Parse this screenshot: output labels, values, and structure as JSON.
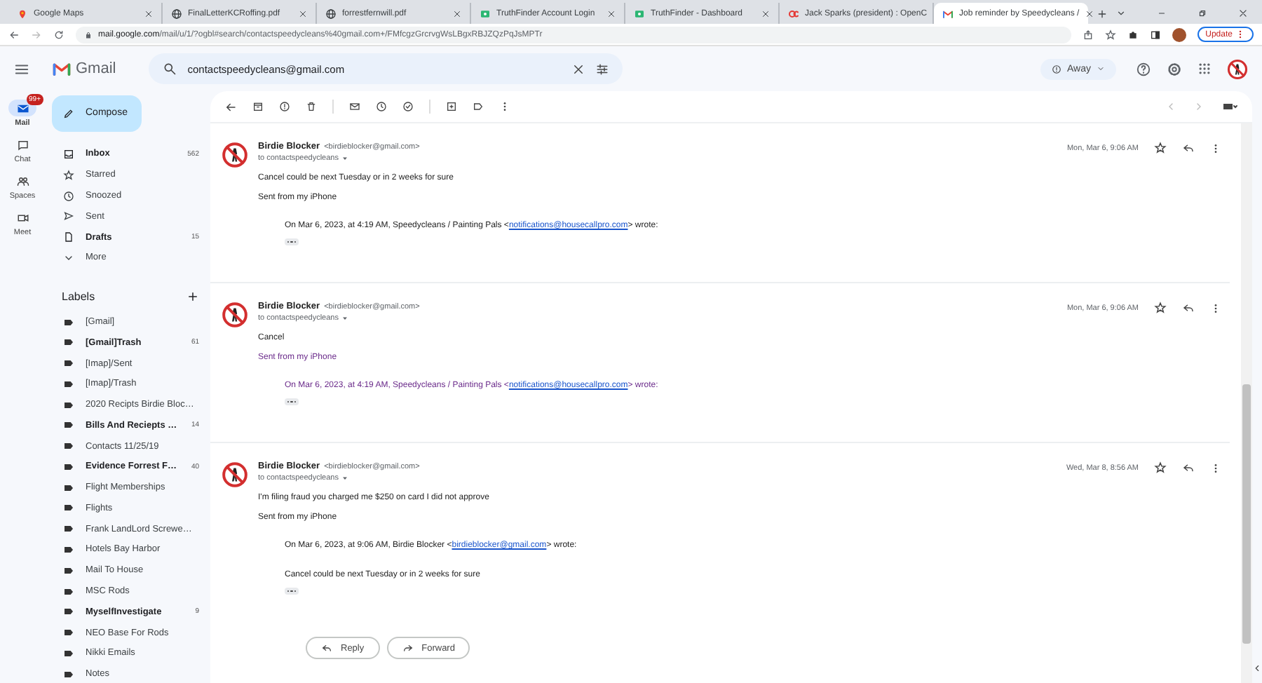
{
  "browser": {
    "tabs": [
      {
        "title": "Google Maps",
        "kind": "pin",
        "selected": false
      },
      {
        "title": "FinalLetterKCRoffing.pdf",
        "kind": "globe",
        "selected": false
      },
      {
        "title": "forrestfernwill.pdf",
        "kind": "globe",
        "selected": false
      },
      {
        "title": "TruthFinder Account Login",
        "kind": "finder",
        "selected": false
      },
      {
        "title": "TruthFinder - Dashboard",
        "kind": "finder",
        "selected": false
      },
      {
        "title": "Jack Sparks (president) : OpenC",
        "kind": "oc",
        "selected": false
      },
      {
        "title": "Job reminder by Speedycleans /",
        "kind": "gmail",
        "selected": true
      }
    ],
    "url_host": "mail.google.com",
    "url_path": "/mail/u/1/?ogbl#search/contactspeedycleans%40gmail.com+/FMfcgzGrcrvgWsLBgxRBJZQzPqJsMPTr",
    "update_label": "Update"
  },
  "gmail": {
    "brand": "Gmail",
    "search_value": "contactspeedycleans@gmail.com",
    "status": "Away"
  },
  "rail": [
    {
      "label": "Mail",
      "kind": "mail",
      "selected": true,
      "badge": "99+"
    },
    {
      "label": "Chat",
      "kind": "chat",
      "selected": false
    },
    {
      "label": "Spaces",
      "kind": "people",
      "selected": false
    },
    {
      "label": "Meet",
      "kind": "video",
      "selected": false
    }
  ],
  "compose": "Compose",
  "folders": [
    {
      "label": "Inbox",
      "kind": "inbox",
      "count": "562",
      "unread": true
    },
    {
      "label": "Starred",
      "kind": "star",
      "unread": false
    },
    {
      "label": "Snoozed",
      "kind": "clock",
      "unread": false
    },
    {
      "label": "Sent",
      "kind": "send",
      "unread": false
    },
    {
      "label": "Drafts",
      "kind": "file",
      "count": "15",
      "unread": true
    },
    {
      "label": "More",
      "kind": "chevron",
      "unread": false
    }
  ],
  "labels_title": "Labels",
  "labels": [
    {
      "name": "[Gmail]",
      "unread": false
    },
    {
      "name": "[Gmail]Trash",
      "count": "61",
      "unread": true
    },
    {
      "name": "[Imap]/Sent",
      "unread": false
    },
    {
      "name": "[Imap]/Trash",
      "unread": false
    },
    {
      "name": "2020 Recipts Birdie Bloc…",
      "unread": false
    },
    {
      "name": "Bills And Reciepts …",
      "count": "14",
      "unread": true
    },
    {
      "name": "Contacts 11/25/19",
      "unread": false
    },
    {
      "name": "Evidence Forrest F…",
      "count": "40",
      "unread": true
    },
    {
      "name": "Flight Memberships",
      "unread": false
    },
    {
      "name": "Flights",
      "unread": false
    },
    {
      "name": "Frank LandLord Screwe…",
      "unread": false
    },
    {
      "name": "Hotels Bay Harbor",
      "unread": false
    },
    {
      "name": "Mail To House",
      "unread": false
    },
    {
      "name": "MSC Rods",
      "unread": false
    },
    {
      "name": "MyselfInvestigate",
      "count": "9",
      "unread": true
    },
    {
      "name": "NEO Base For Rods",
      "unread": false
    },
    {
      "name": "Nikki Emails",
      "unread": false
    },
    {
      "name": "Notes",
      "unread": false
    }
  ],
  "messages": [
    {
      "sender": "Birdie Blocker",
      "email": "<birdieblocker@gmail.com>",
      "to": "to contactspeedycleans",
      "date": "Mon, Mar 6, 9:06 AM",
      "body": [
        {
          "text": "Cancel could be next Tuesday or in 2 weeks for sure"
        },
        {
          "text": "Sent from my iPhone"
        }
      ],
      "quote": {
        "prefix": "On Mar 6, 2023, at 4:19 AM, Speedycleans / Painting Pals <",
        "link": "notifications@housecallpro.com",
        "suffix": "> wrote:"
      }
    },
    {
      "sender": "Birdie Blocker",
      "email": "<birdieblocker@gmail.com>",
      "to": "to contactspeedycleans",
      "date": "Mon, Mar 6, 9:06 AM",
      "body": [
        {
          "text": "Cancel"
        },
        {
          "text": "Sent from my iPhone",
          "color": "#6a2a8a"
        }
      ],
      "quote": {
        "prefix": "On Mar 6, 2023, at 4:19 AM, Speedycleans / Painting Pals <",
        "link": "notifications@housecallpro.com",
        "suffix": "> wrote:",
        "color": "#6a2a8a"
      }
    },
    {
      "sender": "Birdie Blocker",
      "email": "<birdieblocker@gmail.com>",
      "to": "to contactspeedycleans",
      "date": "Wed, Mar 8, 8:56 AM",
      "body": [
        {
          "text": "I'm filing fraud you charged me $250 on card I did not approve"
        },
        {
          "text": "Sent from my iPhone"
        }
      ],
      "quote": {
        "prefix": "On Mar 6, 2023, at 9:06 AM, Birdie Blocker <",
        "link": "birdieblocker@gmail.com",
        "suffix": "> wrote:",
        "body": "Cancel could be next Tuesday or in 2 weeks for sure"
      }
    }
  ],
  "actions": [
    {
      "label": "Reply",
      "kind": "reply"
    },
    {
      "label": "Forward",
      "kind": "forward"
    }
  ]
}
